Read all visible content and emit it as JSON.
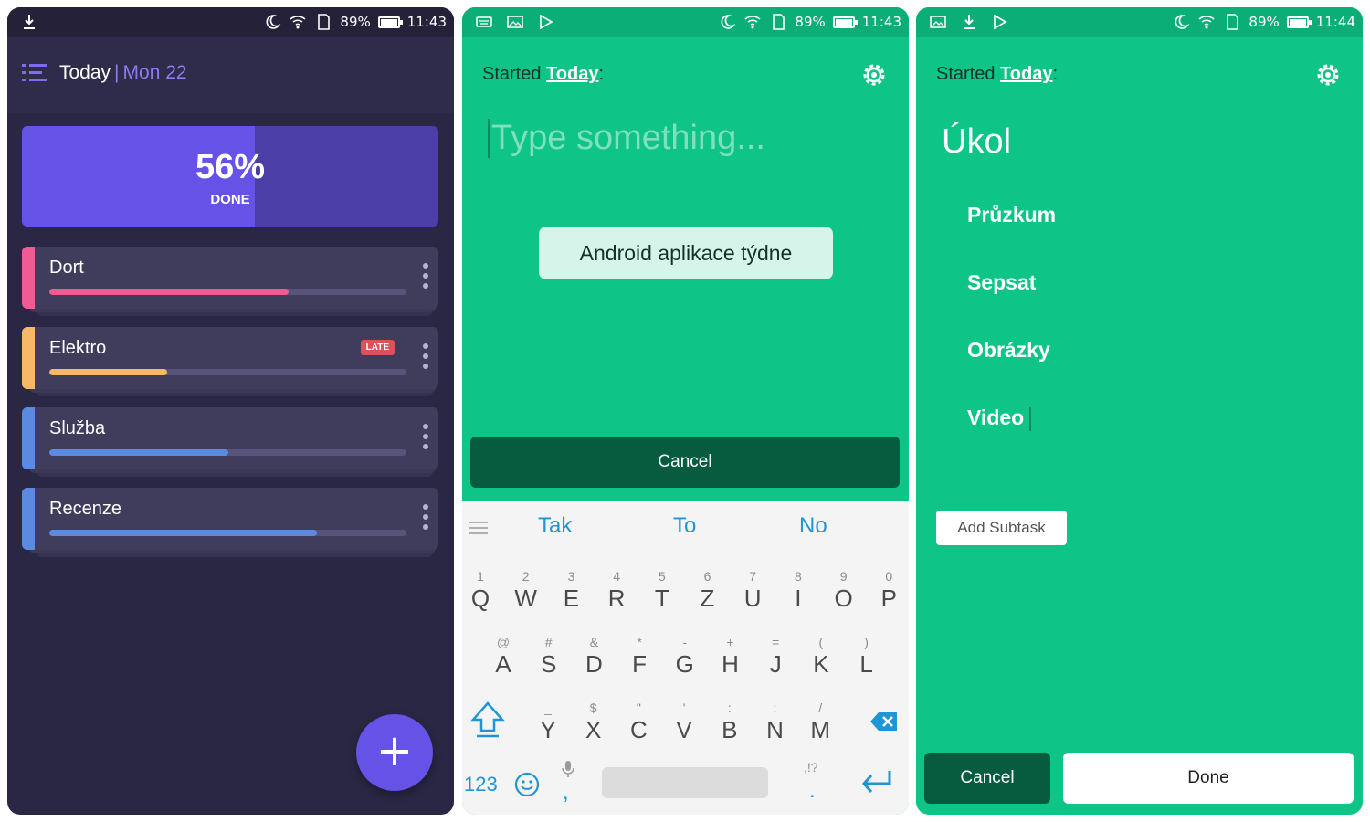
{
  "colors": {
    "dark_bg": "#2a2744",
    "accent_purple": "#6552e6",
    "green_bg": "#0fc487",
    "dark_green": "#075c40",
    "keyboard_blue": "#1f95d6"
  },
  "screen1": {
    "status": {
      "battery": "89%",
      "time": "11:43"
    },
    "header": {
      "title": "Today",
      "separator": "|",
      "date": "Mon 22"
    },
    "progress": {
      "percent_text": "56%",
      "label": "DONE",
      "fraction": 0.56
    },
    "tasks": [
      {
        "name": "Dort",
        "color": "#ef5b92",
        "progress": 0.67,
        "badge": ""
      },
      {
        "name": "Elektro",
        "color": "#f7b86a",
        "progress": 0.33,
        "badge": "LATE"
      },
      {
        "name": "Služba",
        "color": "#5b8be0",
        "progress": 0.5,
        "badge": ""
      },
      {
        "name": "Recenze",
        "color": "#5b8be0",
        "progress": 0.75,
        "badge": ""
      }
    ],
    "fab_label": "+"
  },
  "screen2": {
    "status": {
      "battery": "89%",
      "time": "11:43"
    },
    "started_prefix": "Started",
    "started_link": "Today",
    "started_suffix": ":",
    "input_placeholder": "Type something...",
    "suggestion_chip": "Android aplikace týdne",
    "cancel_label": "Cancel",
    "keyboard": {
      "suggestions": [
        "Tak",
        "To",
        "No"
      ],
      "row1": [
        {
          "sub": "1",
          "main": "Q"
        },
        {
          "sub": "2",
          "main": "W"
        },
        {
          "sub": "3",
          "main": "E"
        },
        {
          "sub": "4",
          "main": "R"
        },
        {
          "sub": "5",
          "main": "T"
        },
        {
          "sub": "6",
          "main": "Z"
        },
        {
          "sub": "7",
          "main": "U"
        },
        {
          "sub": "8",
          "main": "I"
        },
        {
          "sub": "9",
          "main": "O"
        },
        {
          "sub": "0",
          "main": "P"
        }
      ],
      "row2": [
        {
          "sub": "@",
          "main": "A"
        },
        {
          "sub": "#",
          "main": "S"
        },
        {
          "sub": "&",
          "main": "D"
        },
        {
          "sub": "*",
          "main": "F"
        },
        {
          "sub": "-",
          "main": "G"
        },
        {
          "sub": "+",
          "main": "H"
        },
        {
          "sub": "=",
          "main": "J"
        },
        {
          "sub": "(",
          "main": "K"
        },
        {
          "sub": ")",
          "main": "L"
        }
      ],
      "row3": [
        {
          "sub": "_",
          "main": "Y"
        },
        {
          "sub": "$",
          "main": "X"
        },
        {
          "sub": "\"",
          "main": "C"
        },
        {
          "sub": "'",
          "main": "V"
        },
        {
          "sub": ":",
          "main": "B"
        },
        {
          "sub": ";",
          "main": "N"
        },
        {
          "sub": "/",
          "main": "M"
        }
      ],
      "numbers_key": "123",
      "comma_key": ",",
      "period_sub": ",!?",
      "period_key": "."
    }
  },
  "screen3": {
    "status": {
      "battery": "89%",
      "time": "11:44"
    },
    "started_prefix": "Started",
    "started_link": "Today",
    "started_suffix": ":",
    "task_title": "Úkol",
    "subtasks": [
      "Průzkum",
      "Sepsat",
      "Obrázky",
      "Video"
    ],
    "add_subtask_label": "Add Subtask",
    "cancel_label": "Cancel",
    "done_label": "Done"
  }
}
